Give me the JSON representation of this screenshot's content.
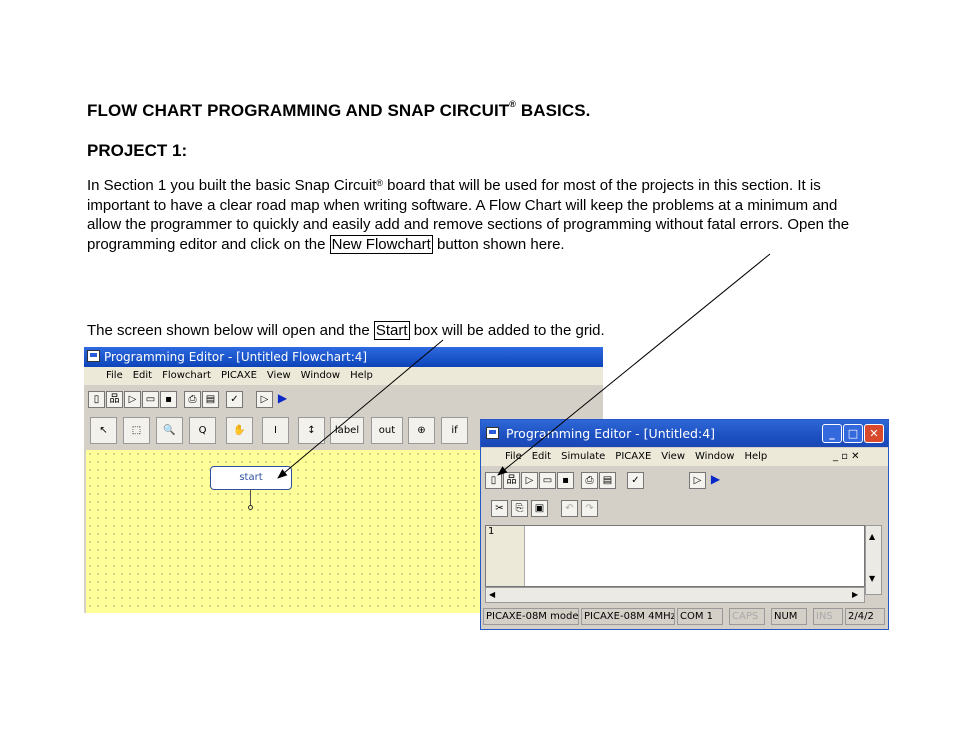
{
  "doc": {
    "title_main": "FLOW CHART PROGRAMMING AND SNAP CIRCUIT",
    "title_sup": "®",
    "title_end": " BASICS.",
    "project": "PROJECT 1:",
    "para1_a": "In Section 1 you built the basic Snap Circuit",
    "para1_sup": "®",
    "para1_b": " board that will be used for most of the projects in this section.  It is important to have a clear road map when writing software. A Flow Chart will keep the problems at a minimum and allow the programmer to quickly and easily add and remove sections of programming without fatal errors. Open the programming editor and click on the ",
    "para1_boxed": "New Flowchart",
    "para1_c": " button shown here.",
    "para2_a": "The screen shown below will open and the ",
    "para2_boxed": "Start",
    "para2_b": " box will be added to the grid."
  },
  "flowchart_window": {
    "title": "Programming Editor  - [Untitled Flowchart:4]",
    "menu": [
      "File",
      "Edit",
      "Flowchart",
      "PICAXE",
      "View",
      "Window",
      "Help"
    ],
    "tools": [
      "↖",
      "⬚",
      "🔍",
      "Q",
      "✋",
      "I",
      "↕",
      "label",
      "out",
      "⊕",
      "if"
    ],
    "start_label": "start"
  },
  "editor_window": {
    "title": "Programming Editor  - [Untitled:4]",
    "menu": [
      "File",
      "Edit",
      "Simulate",
      "PICAXE",
      "View",
      "Window",
      "Help"
    ],
    "line_number": "1",
    "status": [
      "PICAXE-08M mode",
      "PICAXE-08M 4MHz",
      "COM 1",
      "CAPS",
      "NUM",
      "INS",
      "2/4/2"
    ]
  }
}
